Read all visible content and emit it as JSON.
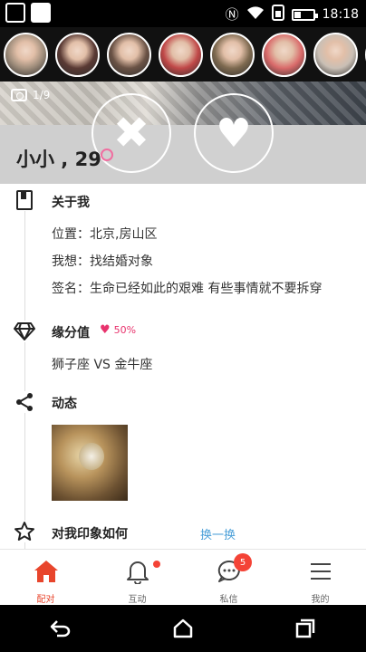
{
  "status_bar": {
    "time": "18:18",
    "icons": [
      "nfc-icon",
      "wifi-icon",
      "sim-icon",
      "battery-icon"
    ],
    "battery_level": 0.35
  },
  "avatars": [
    {
      "name": "avatar-1",
      "color": "#a08e7c"
    },
    {
      "name": "avatar-2",
      "color": "#5a3a34"
    },
    {
      "name": "avatar-3",
      "color": "#6b5346"
    },
    {
      "name": "avatar-4",
      "color": "#c04848"
    },
    {
      "name": "avatar-5",
      "color": "#7e6a50"
    },
    {
      "name": "avatar-6",
      "color": "#d96a6a"
    },
    {
      "name": "avatar-7",
      "color": "#c9bfb5"
    },
    {
      "name": "avatar-8",
      "color": "#555555"
    }
  ],
  "hero": {
    "photo_counter": "1/9",
    "name_age": "小小 , 29",
    "reject_icon": "✖",
    "like_icon": "♥"
  },
  "about": {
    "title": "关于我",
    "location": "位置：北京,房山区",
    "seeking": "我想：找结婚对象",
    "signature": "签名：生命已经如此的艰难 有些事情就不要拆穿"
  },
  "match": {
    "title": "缘分值",
    "percent": "50%",
    "zodiac": "狮子座  VS  金牛座"
  },
  "moments": {
    "title": "动态"
  },
  "impression": {
    "title": "对我印象如何",
    "action": "换一换"
  },
  "nav": {
    "match": "配对",
    "interact": "互动",
    "messages": "私信",
    "mine": "我的",
    "message_badge": "5"
  },
  "colors": {
    "accent_red": "#e8452c",
    "pink": "#e8336d",
    "link_blue": "#4a9fd8"
  }
}
